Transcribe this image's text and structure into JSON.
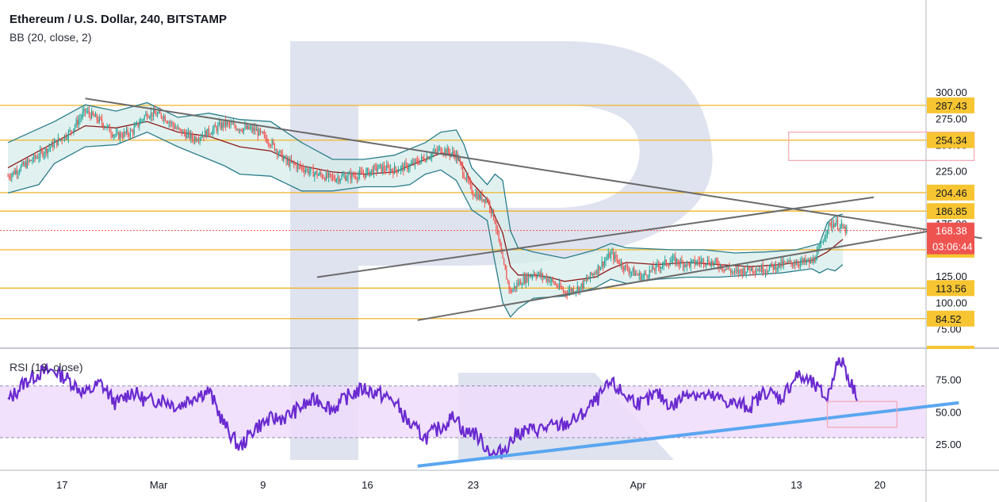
{
  "header": {
    "symbol_title": "Ethereum / U.S. Dollar, 240, BITSTAMP",
    "bb_label": "BB (20, close, 2)",
    "rsi_label": "RSI (13, close)"
  },
  "colors": {
    "candle_up": "#26a69a",
    "candle_down": "#ef5350",
    "level_line": "#f0b429",
    "level_tag_bg": "#f7c531",
    "last_price_tag": "#ef5350",
    "bb_band": "#2a7d8c",
    "bb_fill": "#d7ecea",
    "bb_basis": "#8b1a1a",
    "trendline": "#6b6b6b",
    "rsi_line": "#6a2ad0",
    "rsi_band_fill": "#efdcfb",
    "rsi_trendline": "#5aa6f0",
    "target_box": "#f4a6b4",
    "watermark": "#d7dceb"
  },
  "chart_data": [
    {
      "type": "candlestick",
      "title": "Ethereum / U.S. Dollar, 240, BITSTAMP",
      "indicator": "BB (20, close, 2)",
      "ylim": [
        62,
        318
      ],
      "x_ticks": [
        "17",
        "Mar",
        "9",
        "16",
        "23",
        "Apr",
        "13",
        "20"
      ],
      "y_ticks": [
        "300.00",
        "275.00",
        "250.00",
        "225.00",
        "175.00",
        "125.00",
        "100.00",
        "75.00"
      ],
      "price_levels": [
        "287.43",
        "254.34",
        "204.46",
        "186.85",
        "150.12",
        "113.56",
        "84.52"
      ],
      "last_price": "168.38",
      "countdown": "03:06:44",
      "close_path": [
        [
          0,
          220
        ],
        [
          4,
          240
        ],
        [
          8,
          262
        ],
        [
          10,
          282
        ],
        [
          12,
          272
        ],
        [
          14,
          258
        ],
        [
          16,
          262
        ],
        [
          18,
          280
        ],
        [
          20,
          278
        ],
        [
          22,
          264
        ],
        [
          24,
          256
        ],
        [
          26,
          262
        ],
        [
          28,
          270
        ],
        [
          30,
          266
        ],
        [
          32,
          264
        ],
        [
          34,
          252
        ],
        [
          36,
          234
        ],
        [
          38,
          228
        ],
        [
          40,
          222
        ],
        [
          42,
          218
        ],
        [
          44,
          220
        ],
        [
          46,
          222
        ],
        [
          48,
          228
        ],
        [
          50,
          226
        ],
        [
          52,
          230
        ],
        [
          54,
          238
        ],
        [
          56,
          246
        ],
        [
          58,
          240
        ],
        [
          59,
          222
        ],
        [
          60,
          206
        ],
        [
          61,
          200
        ],
        [
          62,
          198
        ],
        [
          63,
          178
        ],
        [
          64,
          138
        ],
        [
          65,
          110
        ],
        [
          66,
          118
        ],
        [
          68,
          128
        ],
        [
          70,
          122
        ],
        [
          72,
          110
        ],
        [
          74,
          114
        ],
        [
          76,
          130
        ],
        [
          78,
          146
        ],
        [
          80,
          132
        ],
        [
          82,
          124
        ],
        [
          84,
          134
        ],
        [
          86,
          140
        ],
        [
          88,
          136
        ],
        [
          90,
          140
        ],
        [
          92,
          136
        ],
        [
          94,
          128
        ],
        [
          96,
          132
        ],
        [
          98,
          132
        ],
        [
          100,
          136
        ],
        [
          102,
          138
        ],
        [
          104,
          138
        ],
        [
          105,
          150
        ],
        [
          106,
          172
        ],
        [
          107,
          176
        ],
        [
          108,
          170
        ],
        [
          108.6,
          168.38
        ]
      ],
      "bb_upper": [
        [
          0,
          252
        ],
        [
          6,
          272
        ],
        [
          10,
          288
        ],
        [
          14,
          282
        ],
        [
          18,
          290
        ],
        [
          22,
          276
        ],
        [
          26,
          280
        ],
        [
          30,
          274
        ],
        [
          34,
          272
        ],
        [
          38,
          252
        ],
        [
          42,
          236
        ],
        [
          46,
          236
        ],
        [
          50,
          240
        ],
        [
          54,
          252
        ],
        [
          56,
          262
        ],
        [
          58,
          264
        ],
        [
          59,
          250
        ],
        [
          60,
          228
        ],
        [
          62,
          212
        ],
        [
          63,
          222
        ],
        [
          64,
          216
        ],
        [
          65,
          168
        ],
        [
          66,
          152
        ],
        [
          68,
          148
        ],
        [
          72,
          142
        ],
        [
          76,
          150
        ],
        [
          78,
          156
        ],
        [
          80,
          152
        ],
        [
          86,
          150
        ],
        [
          90,
          150
        ],
        [
          94,
          147
        ],
        [
          98,
          148
        ],
        [
          102,
          150
        ],
        [
          105,
          156
        ],
        [
          106,
          176
        ],
        [
          107,
          182
        ],
        [
          108,
          184
        ]
      ],
      "bb_lower": [
        [
          0,
          204
        ],
        [
          4,
          212
        ],
        [
          6,
          232
        ],
        [
          10,
          248
        ],
        [
          14,
          250
        ],
        [
          18,
          262
        ],
        [
          22,
          248
        ],
        [
          26,
          236
        ],
        [
          28,
          230
        ],
        [
          30,
          222
        ],
        [
          34,
          220
        ],
        [
          38,
          206
        ],
        [
          42,
          206
        ],
        [
          46,
          210
        ],
        [
          50,
          210
        ],
        [
          52,
          212
        ],
        [
          54,
          222
        ],
        [
          56,
          226
        ],
        [
          58,
          216
        ],
        [
          60,
          188
        ],
        [
          62,
          178
        ],
        [
          63,
          138
        ],
        [
          64,
          100
        ],
        [
          65,
          86
        ],
        [
          66,
          94
        ],
        [
          68,
          104
        ],
        [
          72,
          106
        ],
        [
          76,
          114
        ],
        [
          78,
          122
        ],
        [
          80,
          118
        ],
        [
          84,
          122
        ],
        [
          88,
          124
        ],
        [
          92,
          124
        ],
        [
          96,
          126
        ],
        [
          100,
          128
        ],
        [
          104,
          132
        ],
        [
          105,
          128
        ],
        [
          106,
          132
        ],
        [
          107,
          130
        ],
        [
          108,
          136
        ]
      ],
      "bb_basis": [
        [
          0,
          228
        ],
        [
          6,
          252
        ],
        [
          10,
          268
        ],
        [
          14,
          266
        ],
        [
          18,
          272
        ],
        [
          22,
          262
        ],
        [
          26,
          258
        ],
        [
          30,
          248
        ],
        [
          34,
          244
        ],
        [
          38,
          230
        ],
        [
          42,
          224
        ],
        [
          46,
          222
        ],
        [
          50,
          224
        ],
        [
          54,
          236
        ],
        [
          56,
          242
        ],
        [
          58,
          240
        ],
        [
          59,
          228
        ],
        [
          60,
          214
        ],
        [
          62,
          198
        ],
        [
          64,
          166
        ],
        [
          65,
          134
        ],
        [
          66,
          126
        ],
        [
          68,
          126
        ],
        [
          70,
          124
        ],
        [
          72,
          120
        ],
        [
          76,
          124
        ],
        [
          78,
          132
        ],
        [
          80,
          138
        ],
        [
          84,
          136
        ],
        [
          88,
          138
        ],
        [
          92,
          136
        ],
        [
          96,
          134
        ],
        [
          100,
          136
        ],
        [
          104,
          140
        ],
        [
          106,
          148
        ],
        [
          108,
          160
        ]
      ],
      "trendlines": [
        {
          "from": [
            10,
            294
          ],
          "to": [
            126,
            161
          ]
        },
        {
          "from": [
            40,
            124
          ],
          "to": [
            112,
            200
          ]
        },
        {
          "from": [
            53,
            83
          ],
          "to": [
            124,
            174
          ]
        }
      ],
      "target_zone": {
        "x0": 101,
        "x1": 125,
        "y0": 235,
        "y1": 262
      }
    },
    {
      "type": "line",
      "title": "RSI (13, close)",
      "ylim": [
        5,
        98
      ],
      "y_ticks": [
        "75.00",
        "50.00",
        "25.00"
      ],
      "band": [
        30,
        70
      ],
      "values": [
        [
          0,
          58
        ],
        [
          2,
          72
        ],
        [
          4,
          80
        ],
        [
          6,
          82
        ],
        [
          8,
          74
        ],
        [
          10,
          64
        ],
        [
          12,
          72
        ],
        [
          14,
          56
        ],
        [
          16,
          66
        ],
        [
          18,
          58
        ],
        [
          20,
          60
        ],
        [
          22,
          54
        ],
        [
          24,
          62
        ],
        [
          26,
          66
        ],
        [
          28,
          40
        ],
        [
          30,
          22
        ],
        [
          32,
          38
        ],
        [
          34,
          44
        ],
        [
          36,
          46
        ],
        [
          38,
          54
        ],
        [
          40,
          60
        ],
        [
          42,
          52
        ],
        [
          44,
          62
        ],
        [
          46,
          68
        ],
        [
          48,
          64
        ],
        [
          50,
          58
        ],
        [
          52,
          40
        ],
        [
          54,
          30
        ],
        [
          56,
          38
        ],
        [
          58,
          48
        ],
        [
          59,
          32
        ],
        [
          60,
          36
        ],
        [
          62,
          22
        ],
        [
          63,
          16
        ],
        [
          64,
          20
        ],
        [
          66,
          34
        ],
        [
          68,
          36
        ],
        [
          70,
          38
        ],
        [
          72,
          40
        ],
        [
          74,
          46
        ],
        [
          76,
          58
        ],
        [
          78,
          72
        ],
        [
          80,
          62
        ],
        [
          82,
          56
        ],
        [
          84,
          64
        ],
        [
          86,
          54
        ],
        [
          88,
          66
        ],
        [
          90,
          62
        ],
        [
          92,
          60
        ],
        [
          94,
          56
        ],
        [
          96,
          54
        ],
        [
          98,
          66
        ],
        [
          100,
          60
        ],
        [
          102,
          78
        ],
        [
          104,
          72
        ],
        [
          106,
          60
        ],
        [
          107,
          84
        ],
        [
          108,
          90
        ],
        [
          109,
          72
        ],
        [
          110,
          62
        ]
      ],
      "trendline": {
        "from": [
          53,
          8
        ],
        "to": [
          123,
          57
        ]
      },
      "target_zone": {
        "x0": 106,
        "x1": 115,
        "y0": 38,
        "y1": 58
      }
    }
  ]
}
